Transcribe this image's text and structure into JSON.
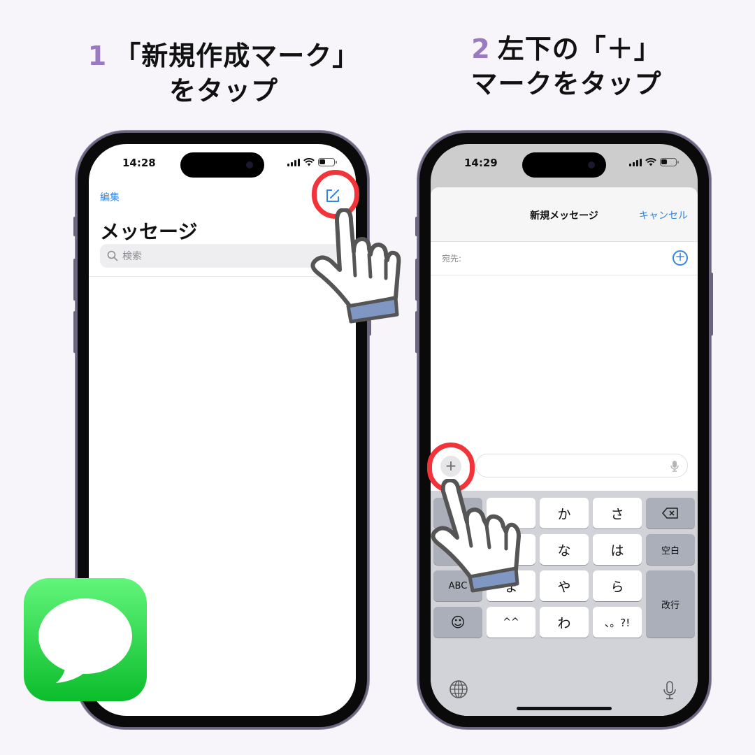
{
  "steps": [
    {
      "number": "1",
      "line1": "「新規作成マーク」",
      "line2": "をタップ"
    },
    {
      "number": "2",
      "line1": "左下の「＋」",
      "line2": "マークをタップ"
    }
  ],
  "phone1": {
    "time": "14:28",
    "edit_label": "編集",
    "title": "メッセージ",
    "search_placeholder": "検索",
    "compose_icon": "compose-icon"
  },
  "phone2": {
    "time": "14:29",
    "sheet_title": "新規メッセージ",
    "cancel_label": "キャンセル",
    "to_label": "宛先:",
    "attach_label": "+",
    "keyboard": {
      "keys": [
        "か",
        "さ",
        "な",
        "は",
        "ま",
        "や",
        "ら",
        "^^",
        "わ",
        "、。?!"
      ],
      "abc_label": "ABC",
      "space_label": "空白",
      "return_label": "改行",
      "emoji_label": "☺",
      "undo_label": "↺",
      "delete_label": "⌫"
    }
  },
  "colors": {
    "accent_blue": "#3385e0",
    "highlight_red": "#f2333a",
    "step_purple": "#9a7ac0",
    "messages_green": "#0bbd2b"
  }
}
